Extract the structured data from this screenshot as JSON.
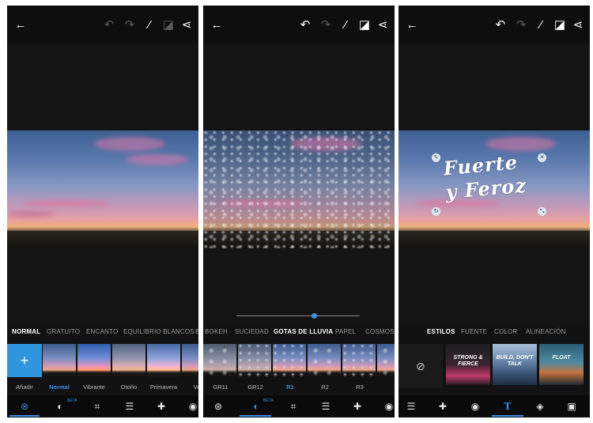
{
  "screens": [
    {
      "topbar": {
        "back_icon": "arrow-left-icon",
        "undo_icon": "undo-icon",
        "redo_icon": "redo-icon",
        "magic_icon": "magic-wand-icon",
        "compare_icon": "compare-icon",
        "share_icon": "share-icon"
      },
      "categories": [
        {
          "label": "NORMAL",
          "active": true
        },
        {
          "label": "GRATUITO",
          "active": false
        },
        {
          "label": "ENCANTO",
          "active": false
        },
        {
          "label": "EQUILIBRIO BLANCOS",
          "active": false
        },
        {
          "label": "B",
          "active": false
        }
      ],
      "add_label": "+",
      "filters": [
        {
          "label": "Añadir",
          "active": false
        },
        {
          "label": "Normal",
          "active": true
        },
        {
          "label": "Vibrante",
          "active": false
        },
        {
          "label": "Otoño",
          "active": false
        },
        {
          "label": "Primavera",
          "active": false
        },
        {
          "label": "Ve",
          "active": false
        }
      ],
      "bottombar": [
        {
          "icon": "filters-icon",
          "active": true
        },
        {
          "icon": "overlay-beta-icon",
          "active": false,
          "badge": "BETA"
        },
        {
          "icon": "crop-icon",
          "active": false
        },
        {
          "icon": "adjust-sliders-icon",
          "active": false
        },
        {
          "icon": "heal-bandage-icon",
          "active": false
        },
        {
          "icon": "eye-icon",
          "active": false
        }
      ]
    },
    {
      "topbar": {
        "back_icon": "arrow-left-icon",
        "undo_icon": "undo-icon",
        "redo_icon": "redo-icon",
        "magic_icon": "magic-wand-icon",
        "compare_icon": "compare-icon",
        "share_icon": "share-icon"
      },
      "slider": {
        "level": 0.63
      },
      "categories": [
        {
          "label": "BOKEH",
          "active": false
        },
        {
          "label": "SUCIEDAD",
          "active": false
        },
        {
          "label": "GOTAS DE LLUVIA",
          "active": true
        },
        {
          "label": "PAPEL",
          "active": false
        },
        {
          "label": "COSMOS",
          "active": false
        }
      ],
      "filters": [
        {
          "label": "GR11",
          "active": false
        },
        {
          "label": "GR12",
          "active": false
        },
        {
          "label": "R1",
          "active": true
        },
        {
          "label": "R2",
          "active": false
        },
        {
          "label": "R3",
          "active": false
        },
        {
          "label": "",
          "active": false
        }
      ],
      "bottombar": [
        {
          "icon": "filters-icon",
          "active": false
        },
        {
          "icon": "overlay-beta-icon",
          "active": true,
          "badge": "BETA"
        },
        {
          "icon": "crop-icon",
          "active": false
        },
        {
          "icon": "adjust-sliders-icon",
          "active": false
        },
        {
          "icon": "heal-bandage-icon",
          "active": false
        },
        {
          "icon": "eye-icon",
          "active": false
        }
      ]
    },
    {
      "topbar": {
        "back_icon": "arrow-left-icon",
        "undo_icon": "undo-icon",
        "redo_icon": "redo-icon",
        "magic_icon": "magic-wand-icon",
        "compare_icon": "compare-icon",
        "share_icon": "share-icon"
      },
      "overlay_text": {
        "line1": "Fuerte",
        "line2": "y Feroz"
      },
      "categories": [
        {
          "label": "ESTILOS",
          "active": true
        },
        {
          "label": "FUENTE",
          "active": false
        },
        {
          "label": "COLOR",
          "active": false
        },
        {
          "label": "ALINEACIÓN",
          "active": false
        }
      ],
      "styles": [
        {
          "text": "STRONG & FIERCE"
        },
        {
          "text": "BUILD, DON'T TALK"
        },
        {
          "text": "FLOAT"
        }
      ],
      "bottombar": [
        {
          "icon": "adjust-sliders-icon",
          "active": false
        },
        {
          "icon": "heal-bandage-icon",
          "active": false
        },
        {
          "icon": "eye-icon",
          "active": false
        },
        {
          "icon": "text-T-icon",
          "active": true
        },
        {
          "icon": "sticker-icon",
          "active": false
        },
        {
          "icon": "frame-icon",
          "active": false
        }
      ]
    }
  ]
}
